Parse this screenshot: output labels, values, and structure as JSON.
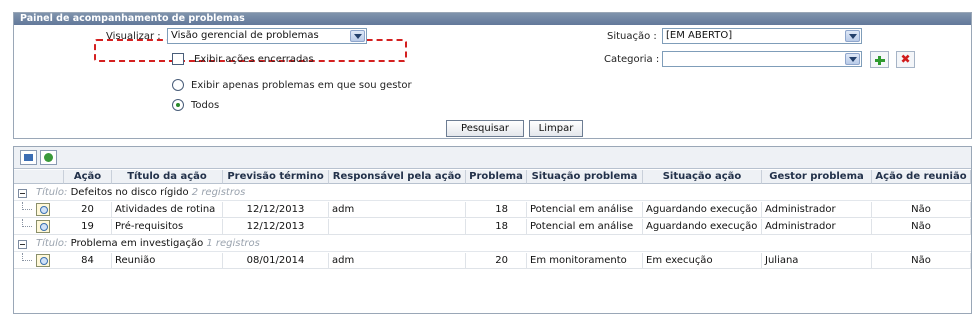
{
  "panel": {
    "title": "Painel de acompanhamento de problemas",
    "visualizar_label": "Visualizar :",
    "visualizar_value": "Visão gerencial de problemas",
    "exibir_acoes_label": "Exibir ações encerradas",
    "radio_gestor_label": "Exibir apenas problemas em que sou gestor",
    "radio_todos_label": "Todos",
    "situacao_label": "Situação :",
    "situacao_value": "[EM ABERTO]",
    "categoria_label": "Categoria :",
    "categoria_value": "",
    "pesquisar_label": "Pesquisar",
    "limpar_label": "Limpar"
  },
  "grid": {
    "columns": [
      "Ação",
      "Título da ação",
      "Previsão término",
      "Responsável pela ação",
      "Problema",
      "Situação problema",
      "Situação ação",
      "Gestor problema",
      "Ação de reunião"
    ],
    "group_prefix": "Título:",
    "groups": [
      {
        "title": "Defeitos no disco rígido",
        "count": "2 registros",
        "rows": [
          [
            "20",
            "Atividades de rotina",
            "12/12/2013",
            "adm",
            "18",
            "Potencial em análise",
            "Aguardando execução",
            "Administrador",
            "Não"
          ],
          [
            "19",
            "Pré-requisitos",
            "12/12/2013",
            "",
            "18",
            "Potencial em análise",
            "Aguardando execução",
            "Administrador",
            "Não"
          ]
        ]
      },
      {
        "title": "Problema em investigação",
        "count": "1 registros",
        "rows": [
          [
            "84",
            "Reunião",
            "08/01/2014",
            "adm",
            "20",
            "Em monitoramento",
            "Em execução",
            "Juliana",
            "Não"
          ]
        ]
      }
    ]
  }
}
